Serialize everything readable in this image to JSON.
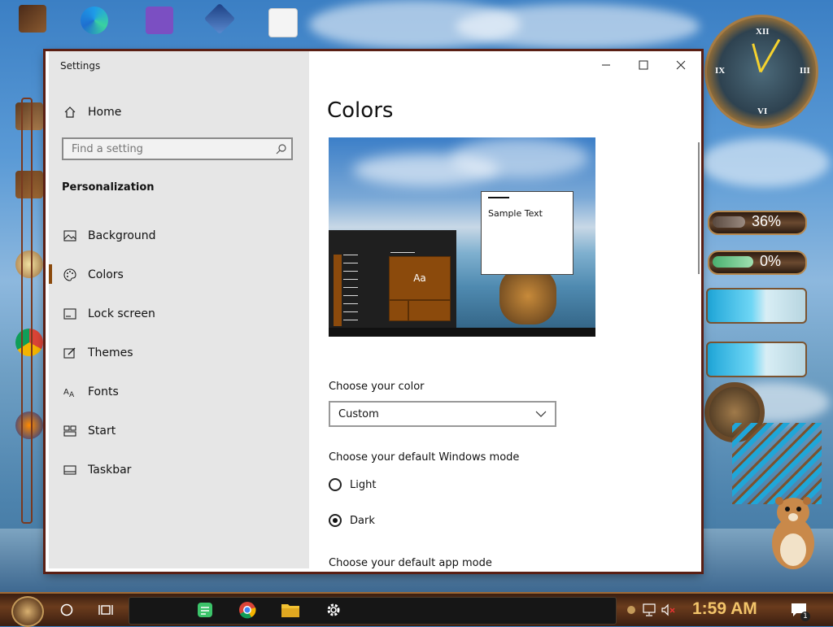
{
  "window": {
    "title": "Settings",
    "controls": {
      "minimize": "minimize",
      "maximize": "maximize",
      "close": "close"
    }
  },
  "sidebar": {
    "home_label": "Home",
    "search_placeholder": "Find a setting",
    "section": "Personalization",
    "items": [
      {
        "label": "Background",
        "icon": "picture-icon"
      },
      {
        "label": "Colors",
        "icon": "palette-icon",
        "active": true
      },
      {
        "label": "Lock screen",
        "icon": "lock-screen-icon"
      },
      {
        "label": "Themes",
        "icon": "brush-icon"
      },
      {
        "label": "Fonts",
        "icon": "fonts-icon"
      },
      {
        "label": "Start",
        "icon": "start-icon"
      },
      {
        "label": "Taskbar",
        "icon": "taskbar-icon"
      }
    ]
  },
  "main": {
    "title": "Colors",
    "preview": {
      "sample_text": "Sample Text",
      "tile_text": "Aa"
    },
    "choose_color_label": "Choose your color",
    "choose_color_value": "Custom",
    "windows_mode_label": "Choose your default Windows mode",
    "modes": [
      {
        "label": "Light",
        "selected": false
      },
      {
        "label": "Dark",
        "selected": true
      }
    ],
    "app_mode_label": "Choose your default app mode"
  },
  "taskbar": {
    "time": "1:59 AM",
    "notification_count": "1"
  },
  "desktop": {
    "gauge_1": "36%",
    "gauge_2": "0%",
    "gauge_1_value": 36,
    "gauge_2_value": 0
  },
  "colors": {
    "accent": "#8b4a0c",
    "sidebar_bg": "#e6e6e6",
    "window_border": "#5a1f14",
    "clock_text": "#f2c46a"
  }
}
